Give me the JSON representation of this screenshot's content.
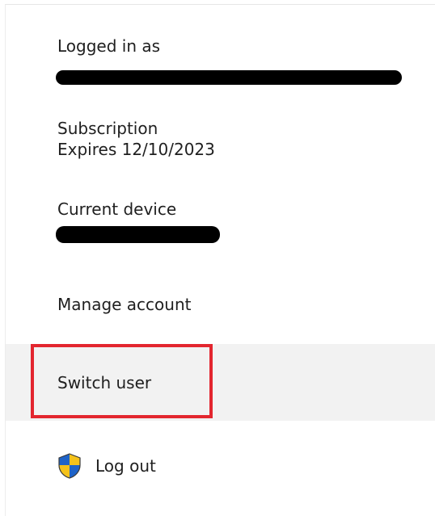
{
  "account": {
    "logged_in_label": "Logged in as",
    "subscription_label": "Subscription",
    "subscription_value": "Expires 12/10/2023",
    "device_label": "Current device"
  },
  "menu": {
    "manage_account": "Manage account",
    "switch_user": "Switch user",
    "log_out": "Log out"
  },
  "icons": {
    "log_out_icon": "uac-shield-icon"
  },
  "colors": {
    "highlight": "#e3262f",
    "hover_bg": "#f2f2f2",
    "redaction": "#000000"
  }
}
